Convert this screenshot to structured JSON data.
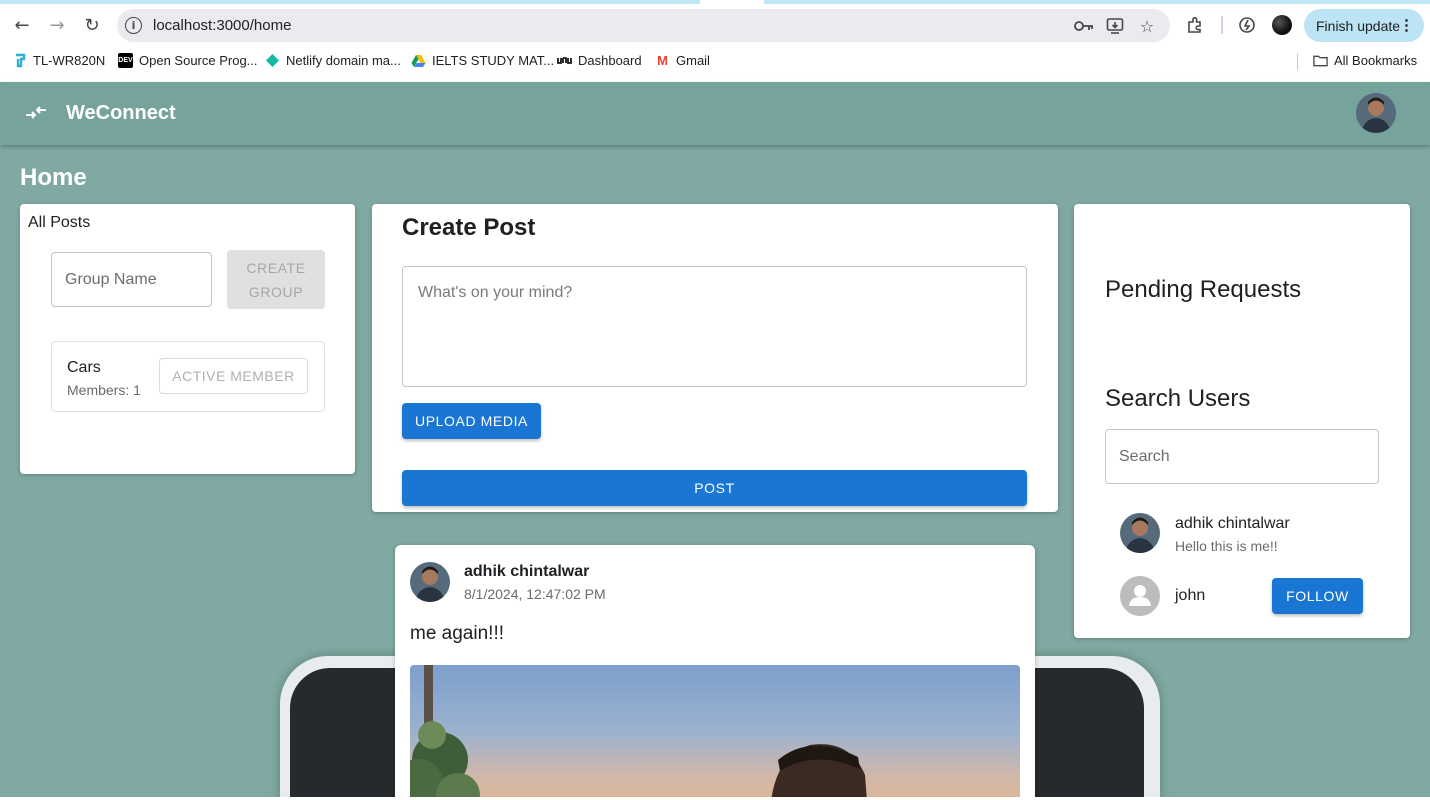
{
  "browser": {
    "url": "localhost:3000/home",
    "finish_update_label": "Finish update",
    "bookmarks": [
      {
        "label": "TL-WR820N",
        "icon": "tp-link-icon"
      },
      {
        "label": "Open Source Prog...",
        "icon": "dev-icon",
        "glyph": "DEV"
      },
      {
        "label": "Netlify domain ma...",
        "icon": "netlify-icon"
      },
      {
        "label": "IELTS STUDY MAT...",
        "icon": "google-drive-icon"
      },
      {
        "label": "Dashboard",
        "icon": "dashboard-icon"
      },
      {
        "label": "Gmail",
        "icon": "gmail-icon",
        "glyph": "M"
      }
    ],
    "all_bookmarks_label": "All Bookmarks"
  },
  "app": {
    "brand": "WeConnect",
    "page_title": "Home",
    "accent_color": "#1976d2",
    "appbar_color": "#76a49d",
    "background_color": "#7fa9a2"
  },
  "groups_panel": {
    "title": "All Posts",
    "group_name_placeholder": "Group Name",
    "create_group_label_line1": "CREATE",
    "create_group_label_line2": "GROUP",
    "groups": [
      {
        "name": "Cars",
        "members": "Members: 1",
        "status_label": "ACTIVE MEMBER"
      }
    ]
  },
  "create_post": {
    "title": "Create Post",
    "placeholder": "What's on your mind?",
    "upload_label": "UPLOAD MEDIA",
    "post_label": "POST"
  },
  "sidebar": {
    "pending_title": "Pending Requests",
    "search_title": "Search Users",
    "search_placeholder": "Search",
    "users": [
      {
        "name": "adhik chintalwar",
        "bio": "Hello this is me!!"
      },
      {
        "name": "john",
        "follow_label": "FOLLOW"
      }
    ]
  },
  "feed": {
    "posts": [
      {
        "author": "adhik chintalwar",
        "timestamp": "8/1/2024, 12:47:02 PM",
        "text": "me again!!!"
      }
    ]
  }
}
